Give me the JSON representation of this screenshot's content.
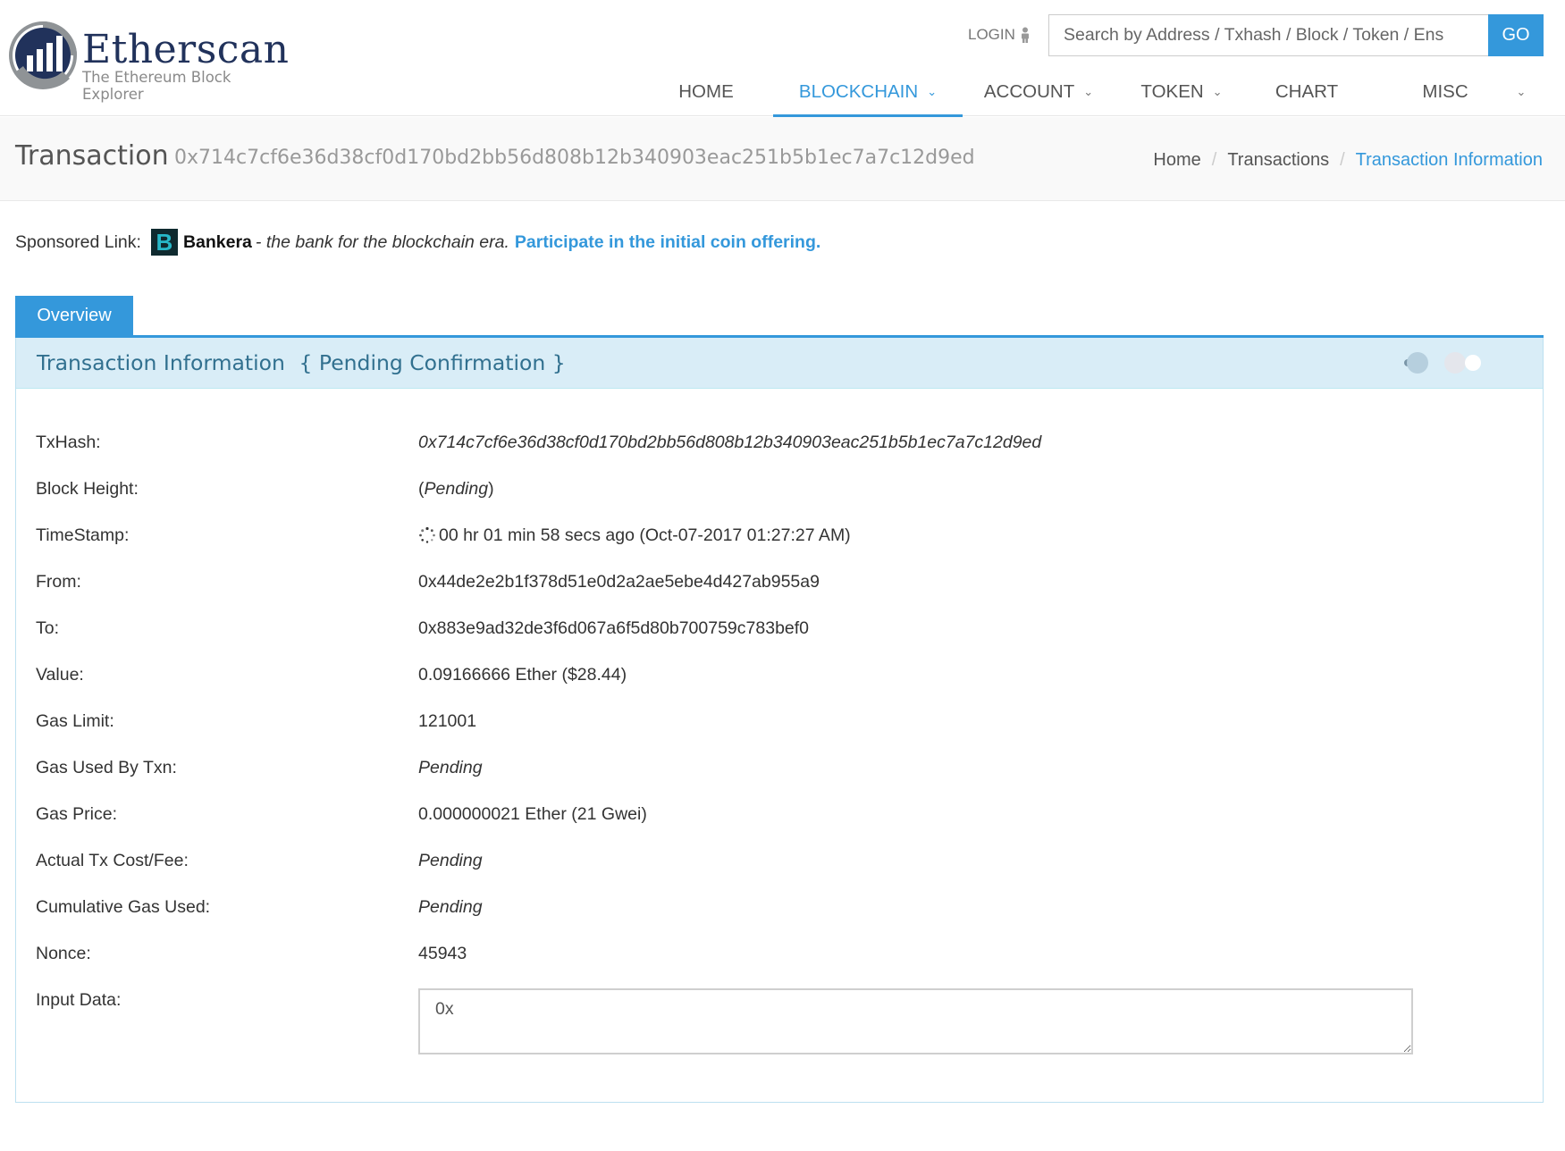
{
  "brand": {
    "name": "Etherscan",
    "tagline": "The Ethereum Block Explorer",
    "logo_icon": "etherscan-logo-icon"
  },
  "header": {
    "login_label": "LOGIN",
    "search_placeholder": "Search by Address / Txhash / Block / Token / Ens",
    "search_button": "GO",
    "nav": [
      {
        "label": "HOME"
      },
      {
        "label": "BLOCKCHAIN"
      },
      {
        "label": "ACCOUNT"
      },
      {
        "label": "TOKEN"
      },
      {
        "label": "CHART"
      },
      {
        "label": "MISC"
      }
    ]
  },
  "page": {
    "title": "Transaction",
    "hash": "0x714c7cf6e36d38cf0d170bd2bb56d808b12b340903eac251b5b1ec7a7c12d9ed",
    "breadcrumb": [
      "Home",
      "Transactions",
      "Transaction Information"
    ]
  },
  "sponsored": {
    "label": "Sponsored Link:",
    "icon_letter": "B",
    "brand": "Bankera",
    "text": "- the bank for the blockchain era.",
    "link": "Participate in the initial coin offering."
  },
  "tab": {
    "label": "Overview"
  },
  "panel": {
    "title": "Transaction Information",
    "status": "{ Pending Confirmation }"
  },
  "details": {
    "txhash": {
      "label": "TxHash:",
      "value": "0x714c7cf6e36d38cf0d170bd2bb56d808b12b340903eac251b5b1ec7a7c12d9ed"
    },
    "block_height": {
      "label": "Block Height:",
      "value": "Pending"
    },
    "timestamp": {
      "label": "TimeStamp:",
      "value": "00 hr 01 min 58 secs ago (Oct-07-2017 01:27:27 AM)"
    },
    "from": {
      "label": "From:",
      "value": "0x44de2e2b1f378d51e0d2a2ae5ebe4d427ab955a9"
    },
    "to": {
      "label": "To:",
      "value": "0x883e9ad32de3f6d067a6f5d80b700759c783bef0"
    },
    "value": {
      "label": "Value:",
      "value": "0.09166666 Ether ($28.44)"
    },
    "gas_limit": {
      "label": "Gas Limit:",
      "value": "121001"
    },
    "gas_used": {
      "label": "Gas Used By Txn:",
      "value": "Pending"
    },
    "gas_price": {
      "label": "Gas Price:",
      "value": "0.000000021 Ether (21 Gwei)"
    },
    "tx_fee": {
      "label": "Actual Tx Cost/Fee:",
      "value": "Pending"
    },
    "cumulative_gas": {
      "label": "Cumulative Gas Used:",
      "value": "Pending"
    },
    "nonce": {
      "label": "Nonce:",
      "value": "45943"
    },
    "input_data": {
      "label": "Input Data:",
      "value": "0x"
    }
  },
  "colors": {
    "accent": "#3498db",
    "panel_head_bg": "#d9edf7",
    "panel_title": "#31708f",
    "logo_navy": "#21325b"
  }
}
